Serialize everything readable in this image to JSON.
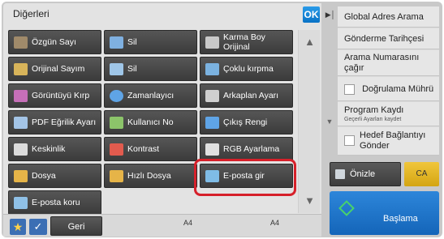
{
  "panel": {
    "title": "Diğerleri",
    "ok_label": "OK"
  },
  "functions": [
    {
      "label": "Özgün Sayı",
      "icon": "original-count-icon",
      "icon_color": "#a08a6a"
    },
    {
      "label": "Sil",
      "icon": "erase-icon",
      "icon_color": "#7fb0e0"
    },
    {
      "label": "Karma Boy Orijinal",
      "icon": "mixed-size-icon",
      "icon_color": "#c9c9c9"
    },
    {
      "label": "Orijinal Sayım",
      "icon": "original-scan-icon",
      "icon_color": "#d8b45a"
    },
    {
      "label": "Sil",
      "icon": "erase-doc-icon",
      "icon_color": "#9fc6e8"
    },
    {
      "label": "Çoklu kırpma",
      "icon": "multi-crop-icon",
      "icon_color": "#7bb2e0"
    },
    {
      "label": "Görüntüyü Kırp",
      "icon": "image-crop-icon",
      "icon_color": "#c66fb8"
    },
    {
      "label": "Zamanlayıcı",
      "icon": "timer-icon",
      "icon_color": "#5fa4e6"
    },
    {
      "label": "Arkaplan Ayarı",
      "icon": "background-icon",
      "icon_color": "#d0d0d0"
    },
    {
      "label": "PDF Eğrilik Ayarı",
      "icon": "pdf-skew-icon",
      "icon_color": "#a3c4e6"
    },
    {
      "label": "Kullanıcı No",
      "icon": "user-number-icon",
      "icon_color": "#8cc46a"
    },
    {
      "label": "Çıkış Rengi",
      "icon": "output-color-icon",
      "icon_color": "#5fa4e6"
    },
    {
      "label": "Keskinlik",
      "icon": "sharpness-icon",
      "icon_color": "#dcdcdc"
    },
    {
      "label": "Kontrast",
      "icon": "contrast-icon",
      "icon_color": "#e25b4e"
    },
    {
      "label": "RGB Ayarlama",
      "icon": "rgb-adjust-icon",
      "icon_color": "#e0e0e0"
    },
    {
      "label": "Dosya",
      "icon": "folder-icon",
      "icon_color": "#e6b448"
    },
    {
      "label": "Hızlı Dosya",
      "icon": "quick-file-icon",
      "icon_color": "#e6b448"
    },
    {
      "label": "E-posta gir",
      "icon": "email-enter-icon",
      "icon_color": "#7fbce6"
    },
    {
      "label": "E-posta koru",
      "icon": "email-protect-icon",
      "icon_color": "#8fc0e6"
    }
  ],
  "bottom": {
    "back_label": "Geri",
    "paper_left": "A4",
    "paper_right": "A4"
  },
  "right": {
    "items": [
      {
        "label": "Global Adres Arama",
        "sub": "",
        "checkbox": false
      },
      {
        "label": "Gönderme Tarihçesi",
        "sub": "",
        "checkbox": false
      },
      {
        "label": "Arama Numarasını çağır",
        "sub": "",
        "checkbox": false
      },
      {
        "label": "Doğrulama Mührü",
        "sub": "",
        "checkbox": true
      },
      {
        "label": "Program Kaydı",
        "sub": "Geçerli Ayarları kaydet",
        "checkbox": false
      },
      {
        "label": "Hedef Bağlantıyı Gönder",
        "sub": "",
        "checkbox": true
      }
    ],
    "preview_label": "Önizle",
    "ca_label": "CA",
    "start_label": "Başlama"
  },
  "colors": {
    "highlight": "#d6202a",
    "start_button": "#1f74c8",
    "ok_button": "#1186dc"
  }
}
